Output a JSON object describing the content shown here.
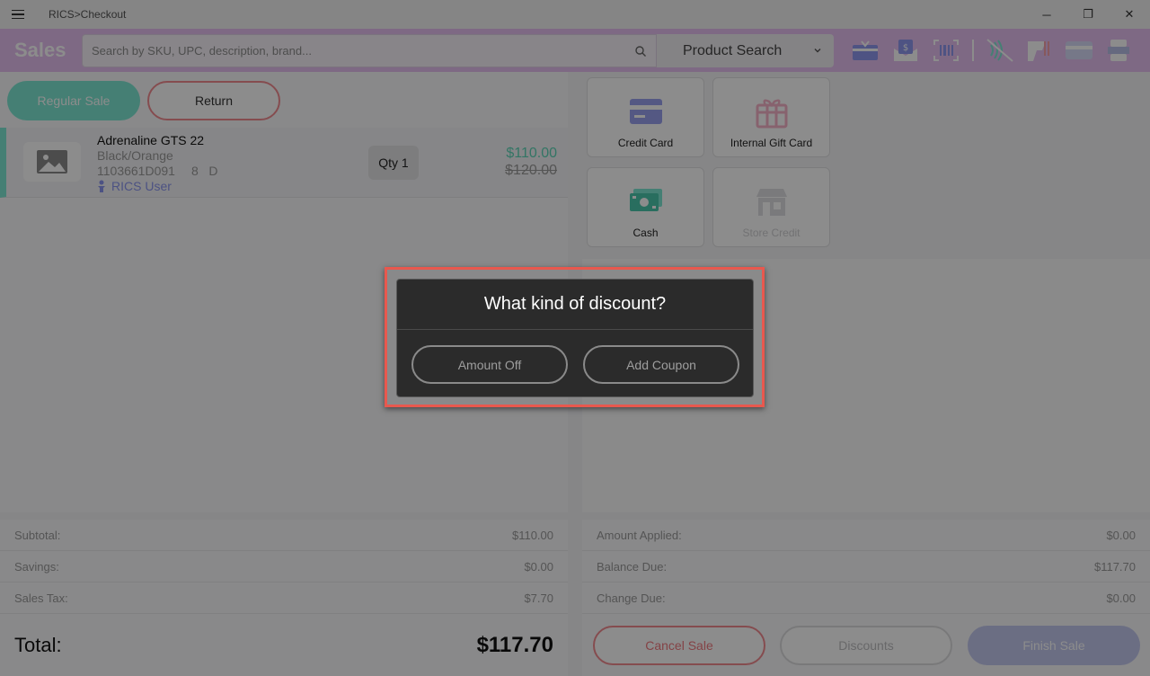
{
  "window": {
    "title": "RICS>Checkout",
    "minimize": "─",
    "restore": "❐",
    "close": "✕"
  },
  "header": {
    "title": "Sales",
    "search_placeholder": "Search by SKU, UPC, description, brand...",
    "search_mode": "Product Search",
    "icons": [
      "gift-card-icon",
      "money-envelope-icon",
      "barcode-scanner-icon",
      "contactless-off-icon",
      "card-reader-icon",
      "payment-card-icon",
      "receipt-printer-icon"
    ],
    "accent_color": "#e5bff0"
  },
  "sale_type": {
    "regular_label": "Regular Sale",
    "return_label": "Return",
    "active": "Regular Sale"
  },
  "cart": {
    "items": [
      {
        "name": "Adrenaline GTS 22",
        "variant": "Black/Orange",
        "sku": "1103661D091",
        "size": "8",
        "width": "D",
        "user": "RICS User",
        "qty_label": "Qty 1",
        "price": "$110.00",
        "original_price": "$120.00"
      }
    ]
  },
  "tenders": [
    {
      "label": "Credit Card",
      "icon": "credit-card-icon",
      "enabled": true
    },
    {
      "label": "Internal Gift Card",
      "icon": "gift-box-icon",
      "enabled": true
    },
    {
      "label": "Cash",
      "icon": "cash-icon",
      "enabled": true
    },
    {
      "label": "Store Credit",
      "icon": "store-icon",
      "enabled": false
    }
  ],
  "totals": {
    "subtotal_label": "Subtotal:",
    "subtotal": "$110.00",
    "savings_label": "Savings:",
    "savings": "$0.00",
    "tax_label": "Sales Tax:",
    "tax": "$7.70",
    "total_label": "Total:",
    "total": "$117.70"
  },
  "payment": {
    "applied_label": "Amount Applied:",
    "applied": "$0.00",
    "balance_label": "Balance Due:",
    "balance": "$117.70",
    "change_label": "Change Due:",
    "change": "$0.00"
  },
  "actions": {
    "cancel": "Cancel Sale",
    "discounts": "Discounts",
    "finish": "Finish Sale"
  },
  "dialog": {
    "title": "What kind of discount?",
    "amount_off": "Amount Off",
    "add_coupon": "Add Coupon"
  }
}
